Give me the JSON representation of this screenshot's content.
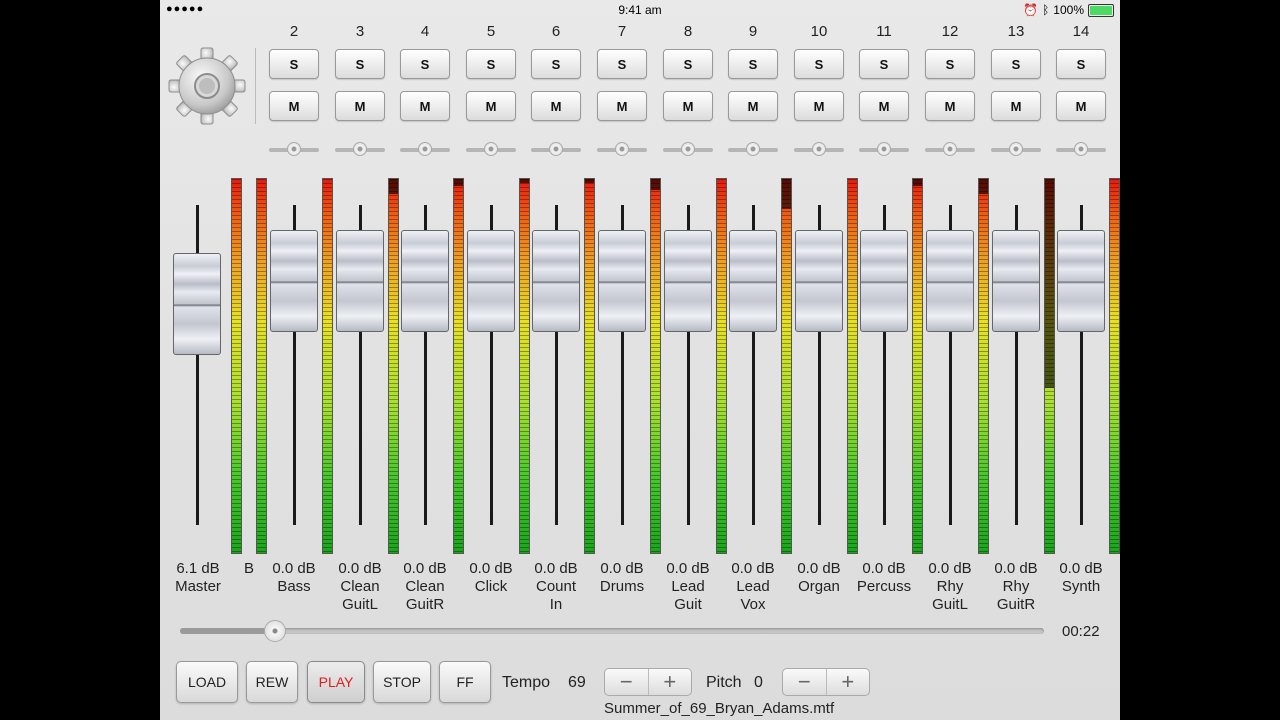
{
  "status_bar": {
    "signal": "●●●●●",
    "time": "9:41 am",
    "battery": "100%"
  },
  "colors": {
    "play_active": "#e0201a",
    "meter_top": "#e81a0a",
    "meter_bottom": "#1aa51a",
    "battery": "#4cd964"
  },
  "master": {
    "db": "6.1 dB",
    "name": "Master",
    "fader_level": 0.78
  },
  "partial_label": "B",
  "channels": [
    {
      "num": "2",
      "db": "0.0 dB",
      "name": "Bass",
      "meter": 1.0
    },
    {
      "num": "3",
      "db": "0.0 dB",
      "name": "Clean\nGuitL",
      "meter": 0.96
    },
    {
      "num": "4",
      "db": "0.0 dB",
      "name": "Clean\nGuitR",
      "meter": 0.98
    },
    {
      "num": "5",
      "db": "0.0 dB",
      "name": "Click",
      "meter": 0.99
    },
    {
      "num": "6",
      "db": "0.0 dB",
      "name": "Count\nIn",
      "meter": 0.99
    },
    {
      "num": "7",
      "db": "0.0 dB",
      "name": "Drums",
      "meter": 0.97
    },
    {
      "num": "8",
      "db": "0.0 dB",
      "name": "Lead\nGuit",
      "meter": 1.0
    },
    {
      "num": "9",
      "db": "0.0 dB",
      "name": "Lead\nVox",
      "meter": 0.92
    },
    {
      "num": "10",
      "db": "0.0 dB",
      "name": "Organ",
      "meter": 1.0
    },
    {
      "num": "11",
      "db": "0.0 dB",
      "name": "Percuss",
      "meter": 0.98
    },
    {
      "num": "12",
      "db": "0.0 dB",
      "name": "Rhy\nGuitL",
      "meter": 0.96
    },
    {
      "num": "13",
      "db": "0.0 dB",
      "name": "Rhy\nGuitR",
      "meter": 0.44
    },
    {
      "num": "14",
      "db": "0.0 dB",
      "name": "Synth",
      "meter": 1.0
    }
  ],
  "solo_label": "S",
  "mute_label": "M",
  "transport": {
    "load": "LOAD",
    "rew": "REW",
    "play": "PLAY",
    "stop": "STOP",
    "ff": "FF",
    "time": "00:22",
    "position": 0.11
  },
  "tempo": {
    "label": "Tempo",
    "value": "69",
    "minus": "−",
    "plus": "+"
  },
  "pitch": {
    "label": "Pitch",
    "value": "0",
    "minus": "−",
    "plus": "+"
  },
  "file": "Summer_of_69_Bryan_Adams.mtf"
}
